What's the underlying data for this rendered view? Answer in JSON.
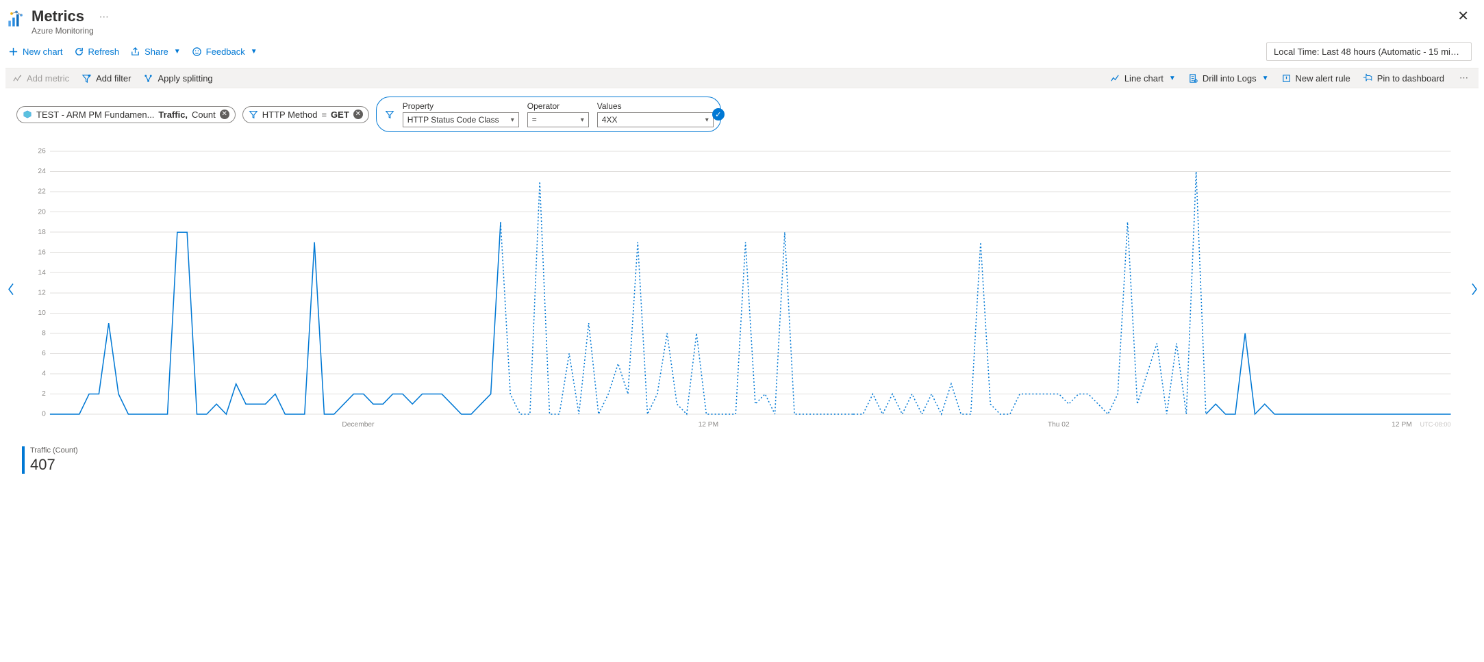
{
  "header": {
    "title": "Metrics",
    "subtitle": "Azure Monitoring"
  },
  "commands": {
    "new_chart": "New chart",
    "refresh": "Refresh",
    "share": "Share",
    "feedback": "Feedback",
    "time_picker": "Local Time: Last 48 hours (Automatic - 15 minut..."
  },
  "chart_toolbar": {
    "add_metric": "Add metric",
    "add_filter": "Add filter",
    "apply_splitting": "Apply splitting",
    "line_chart": "Line chart",
    "drill_logs": "Drill into Logs",
    "new_alert": "New alert rule",
    "pin_dashboard": "Pin to dashboard"
  },
  "metric_pill": {
    "resource": "TEST - ARM PM Fundamen...",
    "metric": "Traffic,",
    "aggregation": "Count"
  },
  "http_filter_pill": {
    "label": "HTTP Method",
    "op": "=",
    "value": "GET"
  },
  "filter_builder": {
    "property_label": "Property",
    "operator_label": "Operator",
    "values_label": "Values",
    "property_value": "HTTP Status Code Class",
    "operator_value": "=",
    "values_value": "4XX"
  },
  "legend": {
    "name": "Traffic (Count)",
    "value": "407"
  },
  "chart_data": {
    "type": "line",
    "title": "",
    "xlabel": "",
    "ylabel": "",
    "ylim": [
      0,
      26
    ],
    "y_ticks": [
      0,
      2,
      4,
      6,
      8,
      10,
      12,
      14,
      16,
      18,
      20,
      22,
      24,
      26
    ],
    "x_ticks": [
      "December",
      "12 PM",
      "Thu 02",
      "12 PM"
    ],
    "utc_offset": "UTC-08:00",
    "series": [
      {
        "name": "Traffic (Count)",
        "style": "solid"
      }
    ],
    "values": [
      0,
      0,
      0,
      0,
      2,
      2,
      9,
      2,
      0,
      0,
      0,
      0,
      0,
      18,
      18,
      0,
      0,
      1,
      0,
      3,
      1,
      1,
      1,
      2,
      0,
      0,
      0,
      17,
      0,
      0,
      1,
      2,
      2,
      1,
      1,
      2,
      2,
      1,
      2,
      2,
      2,
      1,
      0,
      0,
      1,
      2,
      19,
      2,
      0,
      0,
      23,
      0,
      0,
      6,
      0,
      9,
      0,
      2,
      5,
      2,
      17,
      0,
      2,
      8,
      1,
      0,
      8,
      0,
      0,
      0,
      0,
      17,
      1,
      2,
      0,
      18,
      0,
      0,
      0,
      0,
      0,
      0,
      0,
      0,
      2,
      0,
      2,
      0,
      2,
      0,
      2,
      0,
      3,
      0,
      0,
      17,
      1,
      0,
      0,
      2,
      2,
      2,
      2,
      2,
      1,
      2,
      2,
      1,
      0,
      2,
      19,
      1,
      4,
      7,
      0,
      7,
      0,
      24,
      0,
      1,
      0,
      0,
      8,
      0,
      1,
      0,
      0,
      0,
      0,
      0,
      0,
      0,
      0,
      0,
      0,
      0,
      0,
      0,
      0,
      0,
      0,
      0,
      0,
      0
    ],
    "gap_indices_dotted": [
      46,
      82
    ]
  }
}
